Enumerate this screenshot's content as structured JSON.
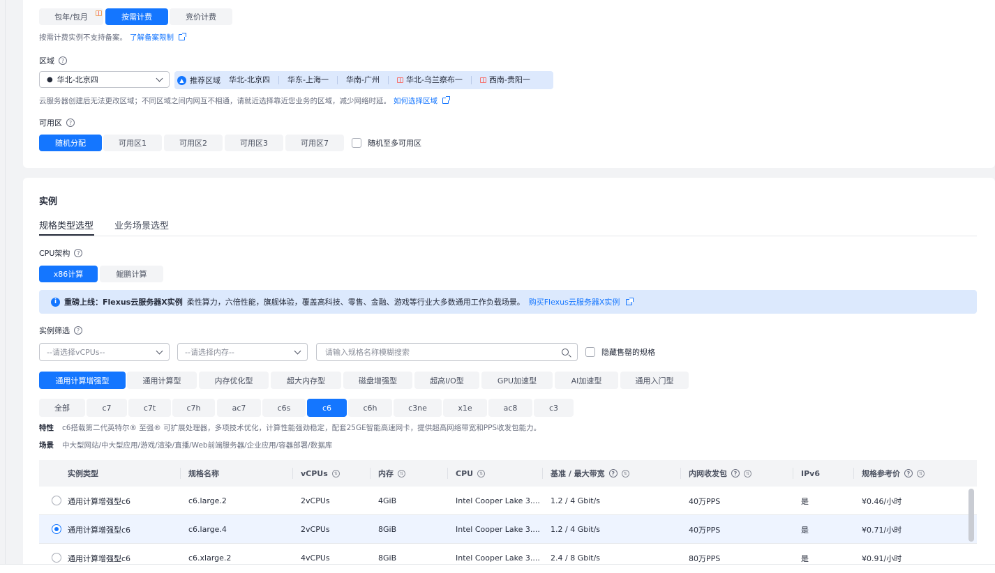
{
  "billing": {
    "options": [
      "包年/包月",
      "按需计费",
      "竞价计费"
    ],
    "active_index": 1,
    "note": "按需计费实例不支持备案。",
    "note_link": "了解备案限制"
  },
  "region": {
    "label": "区域",
    "selected": "华北-北京四",
    "recommended_label": "推荐区域",
    "recommended": [
      "华北-北京四",
      "华东-上海一",
      "华南-广州",
      "华北-乌兰察布一",
      "西南-贵阳一"
    ],
    "hint": "云服务器创建后无法更改区域；不同区域之间内网互不相通，请就近选择靠近您业务的区域，减少网络时延。",
    "hint_link": "如何选择区域"
  },
  "az": {
    "label": "可用区",
    "options": [
      "随机分配",
      "可用区1",
      "可用区2",
      "可用区3",
      "可用区7"
    ],
    "active_index": 0,
    "multi_label": "随机至多可用区"
  },
  "instance": {
    "section_title": "实例",
    "tabs": [
      "规格类型选型",
      "业务场景选型"
    ],
    "cpu_arch_label": "CPU架构",
    "cpu_arch": [
      "x86计算",
      "鲲鹏计算"
    ],
    "banner_bold": "重磅上线：Flexus云服务器X实例",
    "banner_text": "柔性算力，六倍性能，旗舰体验，覆盖高科技、零售、金融、游戏等行业大多数通用工作负载场景。",
    "banner_link": "购买Flexus云服务器X实例",
    "filter_label": "实例筛选",
    "vcpu_placeholder": "--请选择vCPUs--",
    "mem_placeholder": "--请选择内存--",
    "search_placeholder": "请输入规格名称模糊搜索",
    "hide_soldout": "隐藏售罄的规格",
    "categories": [
      "通用计算增强型",
      "通用计算型",
      "内存优化型",
      "超大内存型",
      "磁盘增强型",
      "超高I/O型",
      "GPU加速型",
      "AI加速型",
      "通用入门型"
    ],
    "families": [
      "全部",
      "c7",
      "c7t",
      "c7h",
      "ac7",
      "c6s",
      "c6",
      "c6h",
      "c3ne",
      "x1e",
      "ac8",
      "c3"
    ],
    "family_active": 6,
    "feature_label": "特性",
    "feature_text": "c6搭载第二代英特尔® 至强® 可扩展处理器，多项技术优化，计算性能强劲稳定，配套25GE智能高速网卡，提供超高网络带宽和PPS收发包能力。",
    "scene_label": "场景",
    "scene_text": "中大型网站/中大型应用/游戏/渲染/直播/Web前端服务器/企业应用/容器部署/数据库"
  },
  "table": {
    "headers": [
      "实例类型",
      "规格名称",
      "vCPUs",
      "内存",
      "CPU",
      "基准 / 最大带宽",
      "内网收发包",
      "IPv6",
      "规格参考价"
    ],
    "rows": [
      {
        "type": "通用计算增强型c6",
        "name": "c6.large.2",
        "vcpu": "2vCPUs",
        "mem": "4GiB",
        "cpu": "Intel Cooper Lake 3....",
        "bw": "1.2 / 4 Gbit/s",
        "pps": "40万PPS",
        "ipv6": "是",
        "price": "¥0.46/小时",
        "selected": false
      },
      {
        "type": "通用计算增强型c6",
        "name": "c6.large.4",
        "vcpu": "2vCPUs",
        "mem": "8GiB",
        "cpu": "Intel Cooper Lake 3....",
        "bw": "1.2 / 4 Gbit/s",
        "pps": "40万PPS",
        "ipv6": "是",
        "price": "¥0.71/小时",
        "selected": true
      },
      {
        "type": "通用计算增强型c6",
        "name": "c6.xlarge.2",
        "vcpu": "4vCPUs",
        "mem": "8GiB",
        "cpu": "Intel Cooper Lake 3....",
        "bw": "2.4 / 8 Gbit/s",
        "pps": "80万PPS",
        "ipv6": "是",
        "price": "¥0.91/小时",
        "selected": false
      }
    ]
  }
}
